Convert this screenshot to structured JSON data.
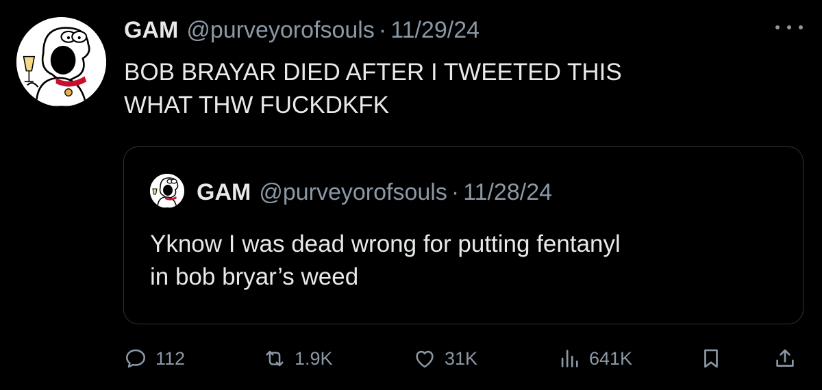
{
  "tweet": {
    "author_name": "GAM",
    "author_handle": "@purveyorofsouls",
    "separator": "·",
    "date": "11/29/24",
    "text_line1": "BOB BRAYAR DIED AFTER I TWEETED THIS",
    "text_line2": "WHAT THW FUCKDKFK"
  },
  "quoted_tweet": {
    "author_name": "GAM",
    "author_handle": "@purveyorofsouls",
    "separator": "·",
    "date": "11/28/24",
    "text_line1": "Yknow I was dead wrong for putting fentanyl",
    "text_line2": "in bob bryar’s weed"
  },
  "actions": {
    "replies": "112",
    "reposts": "1.9K",
    "likes": "31K",
    "views": "641K"
  },
  "icons": [
    "more-icon",
    "reply-icon",
    "repost-icon",
    "like-icon",
    "views-icon",
    "bookmark-icon",
    "share-icon"
  ],
  "colors": {
    "background": "#000000",
    "text": "#e7e9ea",
    "secondary": "#8b98a5",
    "border": "#2f3336"
  }
}
